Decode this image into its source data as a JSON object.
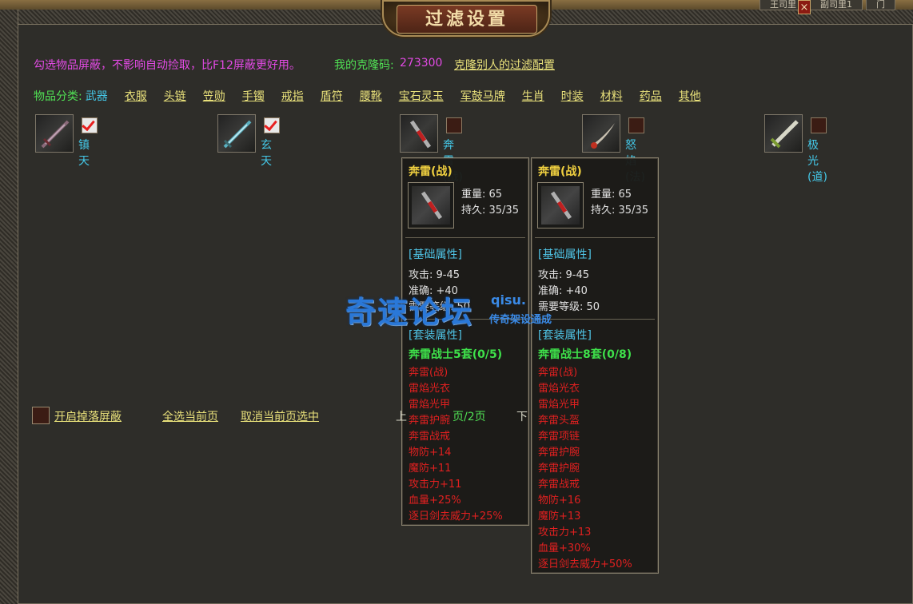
{
  "window": {
    "title": "过滤设置",
    "top_tabs": [
      "王司里",
      "副司里1",
      "门"
    ],
    "close_glyph": "×"
  },
  "header": {
    "notice": "勾选物品屏蔽，不影响自动捡取，比F12屏蔽更好用。",
    "clone_code_label": "我的克隆码:",
    "clone_code_value": "273300",
    "clone_link": "克隆别人的过滤配置"
  },
  "categories": {
    "label": "物品分类:",
    "items": [
      "武器",
      "衣服",
      "头链",
      "笠勋",
      "手镯",
      "戒指",
      "盾符",
      "腰靴",
      "宝石灵玉",
      "军鼓马牌",
      "生肖",
      "时装",
      "材料",
      "药品",
      "其他"
    ],
    "active_index": 0
  },
  "items": [
    {
      "name": "镇天",
      "checked": true,
      "icon": "dark-sword-icon"
    },
    {
      "name": "玄天",
      "checked": true,
      "icon": "blue-sword-icon"
    },
    {
      "name": "奔雷(战)",
      "checked": false,
      "icon": "thunder-sword-icon"
    },
    {
      "name": "怒焰(法)",
      "checked": false,
      "icon": "flame-blade-icon"
    },
    {
      "name": "极光(道)",
      "checked": false,
      "icon": "aurora-sword-icon"
    }
  ],
  "tooltips": [
    {
      "title": "奔雷(战)",
      "weight": "重量: 65",
      "durability": "持久: 35/35",
      "base_header": "[基础属性]",
      "attack": "攻击: 9-45",
      "accuracy": "准确: +40",
      "level": "需要等级: 50",
      "set_header": "[套装属性]",
      "set_name": "奔雷战士5套(0/5)",
      "set_items": [
        "奔雷(战)",
        "雷焰光衣",
        "雷焰光甲",
        "奔雷护腕",
        "奔雷战戒",
        "物防+14",
        "魔防+11",
        "攻击力+11",
        "血量+25%",
        "逐日剑去威力+25%"
      ]
    },
    {
      "title": "奔雷(战)",
      "weight": "重量: 65",
      "durability": "持久: 35/35",
      "base_header": "[基础属性]",
      "attack": "攻击: 9-45",
      "accuracy": "准确: +40",
      "level": "需要等级: 50",
      "set_header": "[套装属性]",
      "set_name": "奔雷战士8套(0/8)",
      "set_items": [
        "奔雷(战)",
        "雷焰光衣",
        "雷焰光甲",
        "奔雷头盔",
        "奔雷项链",
        "奔雷护腕",
        "奔雷护腕",
        "奔雷战戒",
        "物防+16",
        "魔防+13",
        "攻击力+13",
        "血量+30%",
        "逐日剑去威力+50%"
      ]
    }
  ],
  "bottom": {
    "drop_filter_label": "开启掉落屏蔽",
    "select_all": "全选当前页",
    "deselect": "取消当前页选中",
    "page_text": "页/2页",
    "prev_fragment": "上",
    "next_fragment": "下"
  },
  "watermark": {
    "main": "奇速论坛",
    "url": "qisu.",
    "sub": "传奇架设通成"
  },
  "colors": {
    "accent_link": "#e8e07a",
    "notice": "#e24ae4",
    "green": "#50e054",
    "cyan": "#44c8e8",
    "set_red": "#e02020",
    "title_gold": "#f0d040"
  }
}
